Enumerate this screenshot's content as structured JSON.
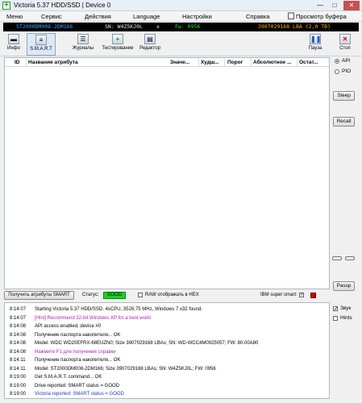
{
  "window": {
    "title": "Victoria 5.37 HDD/SSD | Device 0",
    "min": "—",
    "max": "□",
    "close": "✕"
  },
  "menu": [
    "Меню",
    "Сервис",
    "Действия",
    "Language",
    "Настройки",
    "Справка"
  ],
  "clipboard": "Просмотр буфера",
  "device": {
    "model": "ST2000DM008-2DM166",
    "serial": "SN: W4Z5KJ0L",
    "x": "x",
    "fw": "Fw: 0956",
    "lba": "3907029168 LBA (2,0 TB)"
  },
  "toolbar": {
    "info": "Инфо",
    "smart": "S.M.A.R.T",
    "logs": "Журналы",
    "test": "Тестирование",
    "editor": "Редактор",
    "pause": "Пауза",
    "stop": "Стоп"
  },
  "table": {
    "columns": [
      "ID",
      "Название атрибута",
      "Значе...",
      "Худш...",
      "Порог",
      "Абсолютное ...",
      "Остат..."
    ]
  },
  "side": {
    "api": "API",
    "pio": "PIO",
    "sleep": "Sleep",
    "recall": "Recall",
    "passp": "Passp"
  },
  "status_row": {
    "get_button": "Получить атрибуты SMART",
    "status_label": "Статус:",
    "status_value": "GOOD",
    "raw_hex": "RAW отображать в HEX",
    "ibm": "IBM super smart:"
  },
  "log": [
    {
      "time": "8:14:07",
      "msg": "Starting Victoria 5.37 HDD/SSD. 4xCPU, 3526,75 MHz, Windows 7 x32 found.",
      "color": "normal"
    },
    {
      "time": "8:14:07",
      "msg": "[Hint] Recommend 32-bit Windows XP for a best work!",
      "color": "purple"
    },
    {
      "time": "8:14:08",
      "msg": "API access enabled, device #0",
      "color": "normal"
    },
    {
      "time": "8:14:08",
      "msg": "Получение паспорта накопителя... OK",
      "color": "normal"
    },
    {
      "time": "8:14:08",
      "msg": "Model: WDC WD20EFRX-68EUZN0; Size 3907029168 LBAs; SN: WD-WCC4M0925057; FW: 80.00A80",
      "color": "normal"
    },
    {
      "time": "8:14:08",
      "msg": "Нажмите F1 для получения справки",
      "color": "purple"
    },
    {
      "time": "8:14:11",
      "msg": "Получение паспорта накопителя... OK",
      "color": "normal"
    },
    {
      "time": "8:14:11",
      "msg": "Model: ST2000DM008-2DM166; Size 3907029168 LBAs; SN: W4Z5KJ0L; FW: 0956",
      "color": "normal"
    },
    {
      "time": "8:19:00",
      "msg": "Get S.M.A.R.T. command... OK",
      "color": "normal"
    },
    {
      "time": "8:19:00",
      "msg": "Drive reported: SMART status = GOOD",
      "color": "normal"
    },
    {
      "time": "8:19:00",
      "msg": "Victoria reported: SMART status = GOOD",
      "color": "blue"
    }
  ],
  "log_side": {
    "sound": "Звук",
    "hints": "Hints"
  }
}
